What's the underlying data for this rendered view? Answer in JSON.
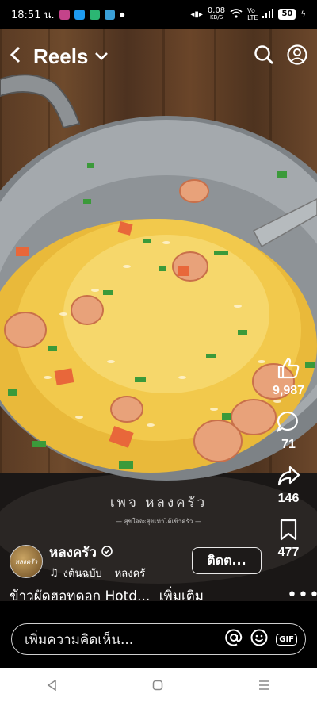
{
  "status": {
    "time": "18:51 น.",
    "net_speed": "0.08",
    "net_unit": "KB/S",
    "battery": "50"
  },
  "header": {
    "title": "Reels"
  },
  "watermark": {
    "main": "เพจ หลงครัว",
    "sub": "— สุขใจจะสุขเท่าได้เข้าครัว —"
  },
  "actions": {
    "likes": "9,987",
    "comments": "71",
    "shares": "146",
    "saves": "477"
  },
  "profile": {
    "name": "หลงครัว",
    "avatar_text": "หลงครัว",
    "music_text": "งต้นฉบับ",
    "music_author": "หลงครั",
    "follow_label": "ติดต..."
  },
  "caption": {
    "text": "ข้าวผัดฮอทดอก  Hotd...",
    "more": "เพิ่มเติม"
  },
  "comment": {
    "placeholder": "เพิ่มความคิดเห็น...",
    "gif_label": "GIF"
  },
  "colors": {
    "rice": "#f2c94c",
    "wok": "#9aa0a4",
    "background_wood": "#5a3b24"
  }
}
